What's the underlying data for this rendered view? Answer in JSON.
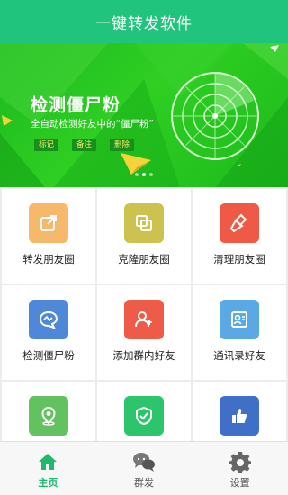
{
  "app": {
    "title": "一键转发软件"
  },
  "banner": {
    "title": "检测僵尸粉",
    "subtitle": "全自动检测好友中的“僵尸粉”",
    "tags": [
      "标记",
      "备注",
      "删除"
    ],
    "slides_total": 3,
    "slide_active_index": 1
  },
  "features": [
    {
      "label": "转发朋友圈",
      "icon": "share-icon",
      "color": "#f6b86a"
    },
    {
      "label": "克隆朋友圈",
      "icon": "clone-icon",
      "color": "#cec24e"
    },
    {
      "label": "清理朋友圈",
      "icon": "broom-icon",
      "color": "#ef5a46"
    },
    {
      "label": "检测僵尸粉",
      "icon": "detect-chat-icon",
      "color": "#4f88d8"
    },
    {
      "label": "添加群内好友",
      "icon": "add-group-friend-icon",
      "color": "#ee5b49"
    },
    {
      "label": "通讯录好友",
      "icon": "contacts-icon",
      "color": "#5aa9e4"
    },
    {
      "label": "",
      "icon": "location-icon",
      "color": "#62c25f"
    },
    {
      "label": "",
      "icon": "shield-check-icon",
      "color": "#2cc56c"
    },
    {
      "label": "",
      "icon": "thumbs-up-icon",
      "color": "#3f6fc6"
    }
  ],
  "tabbar": {
    "tabs": [
      {
        "label": "主页",
        "icon": "home-icon",
        "active": true
      },
      {
        "label": "群发",
        "icon": "chat-bubbles-icon",
        "active": false
      },
      {
        "label": "设置",
        "icon": "gear-icon",
        "active": false
      }
    ],
    "active_color": "#1fb86f"
  },
  "theme": {
    "primary": "#21c47d",
    "banner_green": "#2fcf23"
  }
}
